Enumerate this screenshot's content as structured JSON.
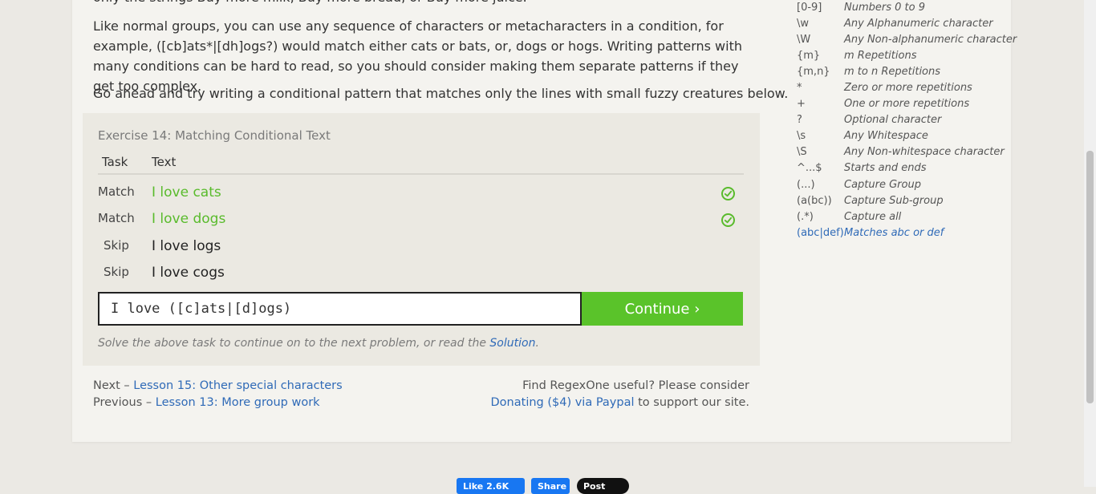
{
  "lesson": {
    "clipped_line": "only the strings Buy more milk, Buy more bread, or Buy more juice.",
    "paragraph": "Like normal groups, you can use any sequence of characters or metacharacters in a condition, for example, ([cb]ats*|[dh]ogs?) would match either cats or bats, or, dogs or hogs. Writing patterns with many conditions can be hard to read, so you should consider making them separate patterns if they get too complex.",
    "instruction": "Go ahead and try writing a conditional pattern that matches only the lines with small fuzzy creatures below."
  },
  "exercise": {
    "title": "Exercise 14: Matching Conditional Text",
    "headers": {
      "task": "Task",
      "text": "Text"
    },
    "rows": [
      {
        "task": "Match",
        "text": "I love cats",
        "matched": true
      },
      {
        "task": "Match",
        "text": "I love dogs",
        "matched": true
      },
      {
        "task": "Skip",
        "text": "I love logs",
        "matched": false
      },
      {
        "task": "Skip",
        "text": "I love cogs",
        "matched": false
      }
    ],
    "input_value": "I love ([c]ats|[d]ogs)",
    "continue_label": "Continue ›",
    "hint_prefix": "Solve the above task to continue on to the next problem, or read the ",
    "hint_link": "Solution",
    "hint_suffix": "."
  },
  "nav": {
    "next_prefix": "Next – ",
    "next_link": "Lesson 15: Other special characters",
    "prev_prefix": "Previous – ",
    "prev_link": "Lesson 13: More group work",
    "donate_line1": "Find RegexOne useful? Please consider",
    "donate_link": "Donating ($4) via Paypal",
    "donate_suffix": " to support our site."
  },
  "reference": [
    {
      "k": "[0-9]",
      "v": "Numbers 0 to 9"
    },
    {
      "k": "\\w",
      "v": "Any Alphanumeric character"
    },
    {
      "k": "\\W",
      "v": "Any Non-alphanumeric character"
    },
    {
      "k": "{m}",
      "v": "m Repetitions"
    },
    {
      "k": "{m,n}",
      "v": "m to n Repetitions"
    },
    {
      "k": "*",
      "v": "Zero or more repetitions"
    },
    {
      "k": "+",
      "v": "One or more repetitions"
    },
    {
      "k": "?",
      "v": "Optional character"
    },
    {
      "k": "\\s",
      "v": "Any Whitespace"
    },
    {
      "k": "\\S",
      "v": "Any Non-whitespace character"
    },
    {
      "k": "^...$",
      "v": "Starts and ends"
    },
    {
      "k": "(...)",
      "v": "Capture Group"
    },
    {
      "k": "(a(bc))",
      "v": "Capture Sub-group"
    },
    {
      "k": "(.*)",
      "v": "Capture all"
    },
    {
      "k": "(abc|def)",
      "v": "Matches abc or def",
      "active": true
    }
  ],
  "social": {
    "fb_like": "Like 2.6K",
    "fb_share": "Share",
    "x_post": "Post"
  },
  "colors": {
    "accent_green": "#5ac32a",
    "link_blue": "#2f6ab7"
  }
}
